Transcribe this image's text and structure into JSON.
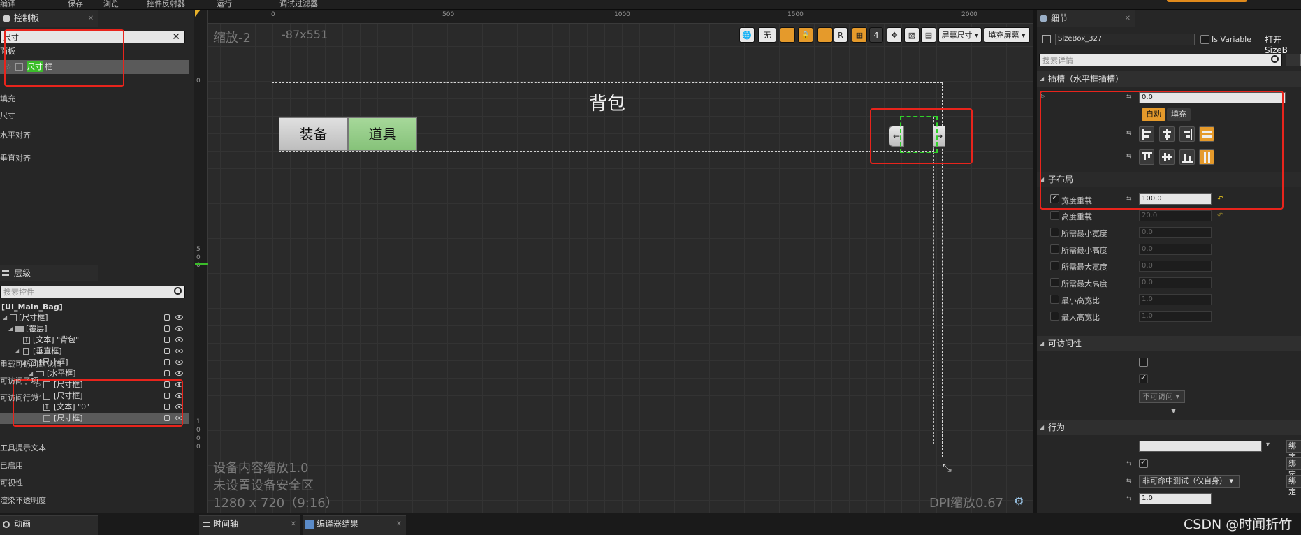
{
  "topbar": {
    "items": [
      "编译",
      "保存",
      "浏览",
      "控件反射器",
      "运行",
      "调试过滤器"
    ]
  },
  "palette": {
    "tab_label": "控制板",
    "search_value": "尺寸",
    "category": "面板",
    "item_prefix": "尺寸",
    "item_suffix": "框"
  },
  "hierarchy": {
    "tab_label": "层级",
    "search_placeholder": "搜索控件",
    "root": "[UI_Main_Bag]",
    "rows": [
      {
        "label": "[尺寸框]"
      },
      {
        "label": "[覆层]"
      },
      {
        "label": "[文本] \"背包\""
      },
      {
        "label": "[垂直框]"
      },
      {
        "label": "[尺寸框]"
      },
      {
        "label": "[水平框]"
      },
      {
        "label": "[尺寸框]"
      },
      {
        "label": "[尺寸框]"
      },
      {
        "label": "[文本] \"0\""
      },
      {
        "label": "[尺寸框]"
      }
    ]
  },
  "designer": {
    "zoom": "缩放-2",
    "cursor": "-87x551",
    "ruler_h": [
      "0",
      "500",
      "1000",
      "1500",
      "2000"
    ],
    "ruler_v": [
      "0",
      "5",
      "0",
      "0",
      "1",
      "0",
      "0",
      "0"
    ],
    "toolbar": {
      "t1": "无",
      "r": "R",
      "four": "4",
      "screen_size": "屏幕尺寸",
      "fill_screen": "填充屏幕"
    },
    "title": "背包",
    "tab_equip": "装备",
    "tab_items": "道具",
    "arrow_left": "←",
    "arrow_right": "→",
    "info1": "设备内容缩放1.0",
    "info2": "未设置设备安全区",
    "info3": "1280 x 720（9:16）",
    "dpi": "DPI缩放0.67"
  },
  "details": {
    "tab_label": "细节",
    "name_value": "SizeBox_327",
    "is_variable": "Is Variable",
    "open_link": "打开SizeB",
    "search_placeholder": "搜索详情",
    "slot_header": "插槽（水平框插槽）",
    "padding_label": "填充",
    "padding_value": "0.0",
    "size_label": "尺寸",
    "size_auto": "自动",
    "size_fill": "填充",
    "halign_label": "水平对齐",
    "valign_label": "垂直对齐",
    "child_layout_header": "子布局",
    "width_override_label": "宽度重载",
    "width_override_value": "100.0",
    "height_override_label": "高度重载",
    "height_override_value": "20.0",
    "min_w_label": "所需最小宽度",
    "min_w_value": "0.0",
    "min_h_label": "所需最小高度",
    "min_h_value": "0.0",
    "max_w_label": "所需最大宽度",
    "max_w_value": "0.0",
    "max_h_label": "所需最大高度",
    "max_h_value": "0.0",
    "min_ar_label": "最小高宽比",
    "min_ar_value": "1.0",
    "max_ar_label": "最大高宽比",
    "max_ar_value": "1.0",
    "access_header": "可访问性",
    "override_access_label": "重载可访问默认值",
    "access_children_label": "可访问子项",
    "access_behavior_label": "可访问行为",
    "access_behavior_value": "不可访问",
    "behavior_header": "行为",
    "tooltip_label": "工具提示文本",
    "enabled_label": "已启用",
    "visibility_label": "可视性",
    "visibility_value": "非可命中测试（仅自身）",
    "opacity_label": "渲染不透明度",
    "opacity_value": "1.0",
    "bind": "绑定"
  },
  "bottom": {
    "anim_tab": "动画",
    "timeline_tab": "时间轴",
    "compiler_tab": "编译器结果",
    "watermark": "CSDN @时闻折竹"
  }
}
